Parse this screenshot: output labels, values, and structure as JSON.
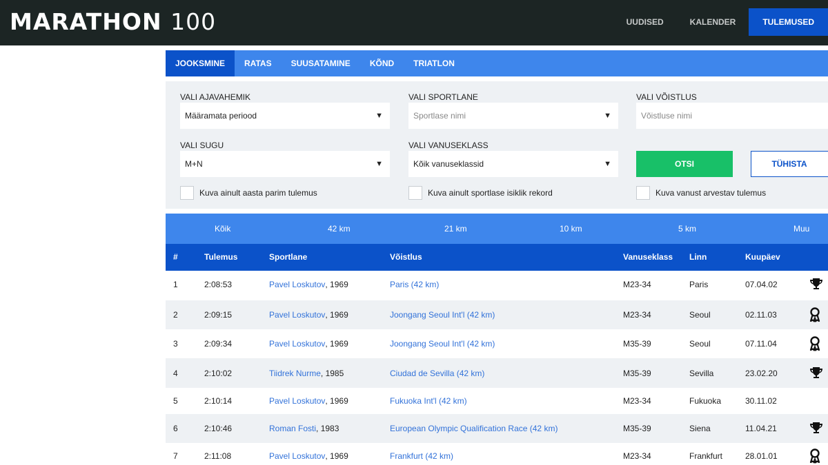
{
  "header": {
    "logo_word": "MARATHON",
    "logo_number": "100",
    "nav": [
      "UUDISED",
      "KALENDER",
      "TULEMUSED"
    ]
  },
  "sport_tabs": [
    "JOOKSMINE",
    "RATAS",
    "SUUSATAMINE",
    "KÕND",
    "TRIATLON"
  ],
  "filters": {
    "period_label": "VALI AJAVAHEMIK",
    "period_value": "Määramata periood",
    "athlete_label": "VALI SPORTLANE",
    "athlete_placeholder": "Sportlase nimi",
    "race_label": "VALI VÕISTLUS",
    "race_placeholder": "Võistluse nimi",
    "gender_label": "VALI SUGU",
    "gender_value": "M+N",
    "age_label": "VALI VANUSEKLASS",
    "age_value": "Kõik vanuseklassid",
    "search_button": "OTSI",
    "clear_button": "TÜHISTA",
    "check_best": "Kuva ainult aasta parim tulemus",
    "check_record": "Kuva ainult sportlase isiklik rekord",
    "check_age": "Kuva vanust arvestav tulemus"
  },
  "distances": [
    "Kõik",
    "42 km",
    "21 km",
    "10 km",
    "5 km",
    "Muu"
  ],
  "table": {
    "headers": [
      "#",
      "Tulemus",
      "Sportlane",
      "Võistlus",
      "Vanuseklass",
      "Linn",
      "Kuupäev"
    ],
    "rows": [
      {
        "rank": "1",
        "time": "2:08:53",
        "athlete": "Pavel Loskutov",
        "year": ", 1969",
        "race": "Paris (42 km)",
        "class": "M23-34",
        "city": "Paris",
        "date": "07.04.02",
        "icon": "trophy-icon"
      },
      {
        "rank": "2",
        "time": "2:09:15",
        "athlete": "Pavel Loskutov",
        "year": ", 1969",
        "race": "Joongang Seoul Int'l (42 km)",
        "class": "M23-34",
        "city": "Seoul",
        "date": "02.11.03",
        "icon": "award-ribbon-icon"
      },
      {
        "rank": "3",
        "time": "2:09:34",
        "athlete": "Pavel Loskutov",
        "year": ", 1969",
        "race": "Joongang Seoul Int'l (42 km)",
        "class": "M35-39",
        "city": "Seoul",
        "date": "07.11.04",
        "icon": "award-ribbon-icon"
      },
      {
        "rank": "4",
        "time": "2:10:02",
        "athlete": "Tiidrek Nurme",
        "year": ", 1985",
        "race": "Ciudad de Sevilla (42 km)",
        "class": "M35-39",
        "city": "Sevilla",
        "date": "23.02.20",
        "icon": "trophy-icon"
      },
      {
        "rank": "5",
        "time": "2:10:14",
        "athlete": "Pavel Loskutov",
        "year": ", 1969",
        "race": "Fukuoka Int'l (42 km)",
        "class": "M23-34",
        "city": "Fukuoka",
        "date": "30.11.02",
        "icon": ""
      },
      {
        "rank": "6",
        "time": "2:10:46",
        "athlete": "Roman Fosti",
        "year": ", 1983",
        "race": "European Olympic Qualification Race (42 km)",
        "class": "M35-39",
        "city": "Siena",
        "date": "11.04.21",
        "icon": "trophy-icon"
      },
      {
        "rank": "7",
        "time": "2:11:08",
        "athlete": "Pavel Loskutov",
        "year": ", 1969",
        "race": "Frankfurt (42 km)",
        "class": "M23-34",
        "city": "Frankfurt",
        "date": "28.01.01",
        "icon": "award-ribbon-icon"
      }
    ]
  },
  "colors": {
    "header_bg": "#1c2524",
    "primary_blue": "#0b52c9",
    "tab_blue": "#3e86ec",
    "link_blue": "#3272d9",
    "search_green": "#18c068",
    "panel_bg": "#eef1f4"
  }
}
